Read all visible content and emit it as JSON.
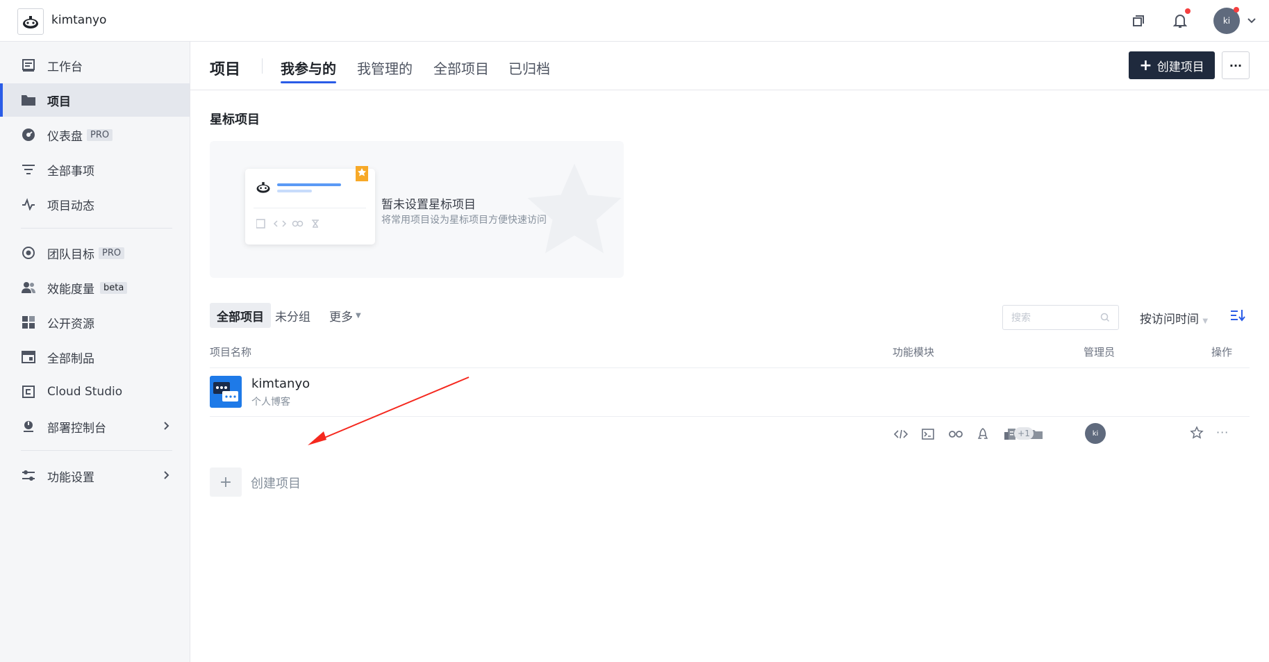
{
  "topbar": {
    "team_name": "kimtanyo",
    "avatar_text": "ki",
    "icons": [
      "logo-icon",
      "window-icon",
      "bell-icon",
      "chevron-down-icon"
    ]
  },
  "sidebar": {
    "items": [
      {
        "label": "工作台",
        "icon": "workbench-icon"
      },
      {
        "label": "项目",
        "icon": "folder-icon"
      },
      {
        "label": "仪表盘",
        "icon": "dashboard-icon",
        "tag": "PRO"
      },
      {
        "label": "全部事项",
        "icon": "filter-icon"
      },
      {
        "label": "项目动态",
        "icon": "activity-icon"
      },
      {
        "label": "团队目标",
        "icon": "target-icon",
        "tag": "PRO"
      },
      {
        "label": "效能度量",
        "icon": "team-icon",
        "tag": "beta"
      },
      {
        "label": "公开资源",
        "icon": "grid-icon"
      },
      {
        "label": "全部制品",
        "icon": "artifact-icon"
      },
      {
        "label": "Cloud Studio",
        "icon": "studio-icon"
      },
      {
        "label": "部署控制台",
        "icon": "deploy-icon"
      },
      {
        "label": "功能设置",
        "icon": "settings-sliders-icon"
      }
    ]
  },
  "main": {
    "title": "项目",
    "tabs": [
      "我参与的",
      "我管理的",
      "全部项目",
      "已归档"
    ],
    "create_button": "创建项目",
    "more_button": "···",
    "star_section": {
      "title": "星标项目",
      "empty_title": "暂未设置星标项目",
      "empty_desc": "将常用项目设为星标项目方便快速访问"
    },
    "filter_tabs": [
      "全部项目",
      "未分组",
      "更多"
    ],
    "search_placeholder": "搜索",
    "sort_label": "按访问时间",
    "columns": [
      "项目名称",
      "功能模块",
      "管理员",
      "操作"
    ],
    "projects": [
      {
        "name": "kimtanyo",
        "desc": "个人博客",
        "modules_extra": "+1",
        "manager": "ki"
      }
    ],
    "add_label": "创建项目",
    "accent": "#2a5ce7",
    "annotation_color": "#f5281e"
  }
}
